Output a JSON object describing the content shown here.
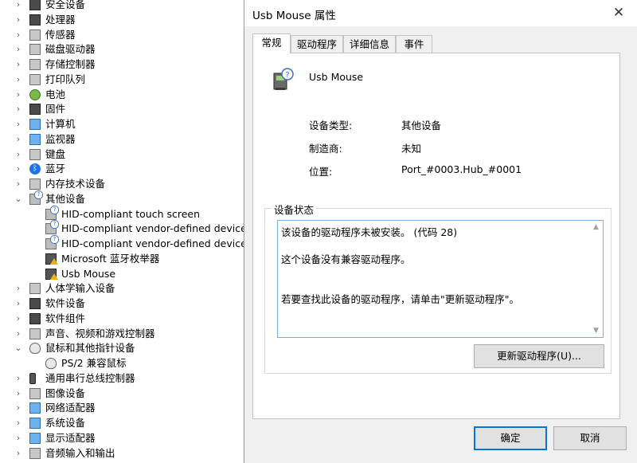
{
  "tree": {
    "items": [
      {
        "label": "安全设备",
        "chevron": "›",
        "icon": "security-key-icon"
      },
      {
        "label": "处理器",
        "chevron": "›",
        "icon": "processor-icon"
      },
      {
        "label": "传感器",
        "chevron": "›",
        "icon": "sensor-icon"
      },
      {
        "label": "磁盘驱动器",
        "chevron": "›",
        "icon": "disk-drive-icon"
      },
      {
        "label": "存储控制器",
        "chevron": "›",
        "icon": "storage-controller-icon"
      },
      {
        "label": "打印队列",
        "chevron": "›",
        "icon": "printer-icon"
      },
      {
        "label": "电池",
        "chevron": "›",
        "icon": "battery-icon"
      },
      {
        "label": "固件",
        "chevron": "›",
        "icon": "firmware-icon"
      },
      {
        "label": "计算机",
        "chevron": "›",
        "icon": "computer-icon"
      },
      {
        "label": "监视器",
        "chevron": "›",
        "icon": "monitor-icon"
      },
      {
        "label": "键盘",
        "chevron": "›",
        "icon": "keyboard-icon"
      },
      {
        "label": "蓝牙",
        "chevron": "›",
        "icon": "bluetooth-icon"
      },
      {
        "label": "内存技术设备",
        "chevron": "›",
        "icon": "memory-icon"
      },
      {
        "label": "其他设备",
        "chevron": "⌄",
        "icon": "unknown-device-icon"
      },
      {
        "label": "HID-compliant touch screen",
        "chevron": "",
        "icon": "unknown-device-icon"
      },
      {
        "label": "HID-compliant vendor-defined device",
        "chevron": "",
        "icon": "unknown-device-icon"
      },
      {
        "label": "HID-compliant vendor-defined device",
        "chevron": "",
        "icon": "unknown-device-icon"
      },
      {
        "label": "Microsoft 蓝牙枚举器",
        "chevron": "",
        "icon": "warning-device-icon"
      },
      {
        "label": "Usb Mouse",
        "chevron": "",
        "icon": "warning-device-icon"
      },
      {
        "label": "人体学输入设备",
        "chevron": "›",
        "icon": "hid-icon"
      },
      {
        "label": "软件设备",
        "chevron": "›",
        "icon": "software-device-icon"
      },
      {
        "label": "软件组件",
        "chevron": "›",
        "icon": "software-component-icon"
      },
      {
        "label": "声音、视频和游戏控制器",
        "chevron": "›",
        "icon": "speaker-icon"
      },
      {
        "label": "鼠标和其他指针设备",
        "chevron": "⌄",
        "icon": "mouse-icon"
      },
      {
        "label": "PS/2 兼容鼠标",
        "chevron": "",
        "icon": "mouse-icon"
      },
      {
        "label": "通用串行总线控制器",
        "chevron": "›",
        "icon": "usb-icon"
      },
      {
        "label": "图像设备",
        "chevron": "›",
        "icon": "camera-icon"
      },
      {
        "label": "网络适配器",
        "chevron": "›",
        "icon": "network-icon"
      },
      {
        "label": "系统设备",
        "chevron": "›",
        "icon": "system-device-icon"
      },
      {
        "label": "显示适配器",
        "chevron": "›",
        "icon": "display-adapter-icon"
      },
      {
        "label": "音频输入和输出",
        "chevron": "›",
        "icon": "audio-icon"
      }
    ]
  },
  "dialog": {
    "title": "Usb Mouse 属性",
    "close_glyph": "✕",
    "tabs": [
      "常规",
      "驱动程序",
      "详细信息",
      "事件"
    ],
    "device_name": "Usb Mouse",
    "props": [
      {
        "label": "设备类型:",
        "value": "其他设备"
      },
      {
        "label": "制造商:",
        "value": "未知"
      },
      {
        "label": "位置:",
        "value": "Port_#0003.Hub_#0001"
      }
    ],
    "status_group_label": "设备状态",
    "status_lines": [
      "该设备的驱动程序未被安装。 (代码 28)",
      "这个设备没有兼容驱动程序。",
      "若要查找此设备的驱动程序，请单击\"更新驱动程序\"。"
    ],
    "update_driver_button": "更新驱动程序(U)...",
    "ok_button": "确定",
    "cancel_button": "取消"
  }
}
